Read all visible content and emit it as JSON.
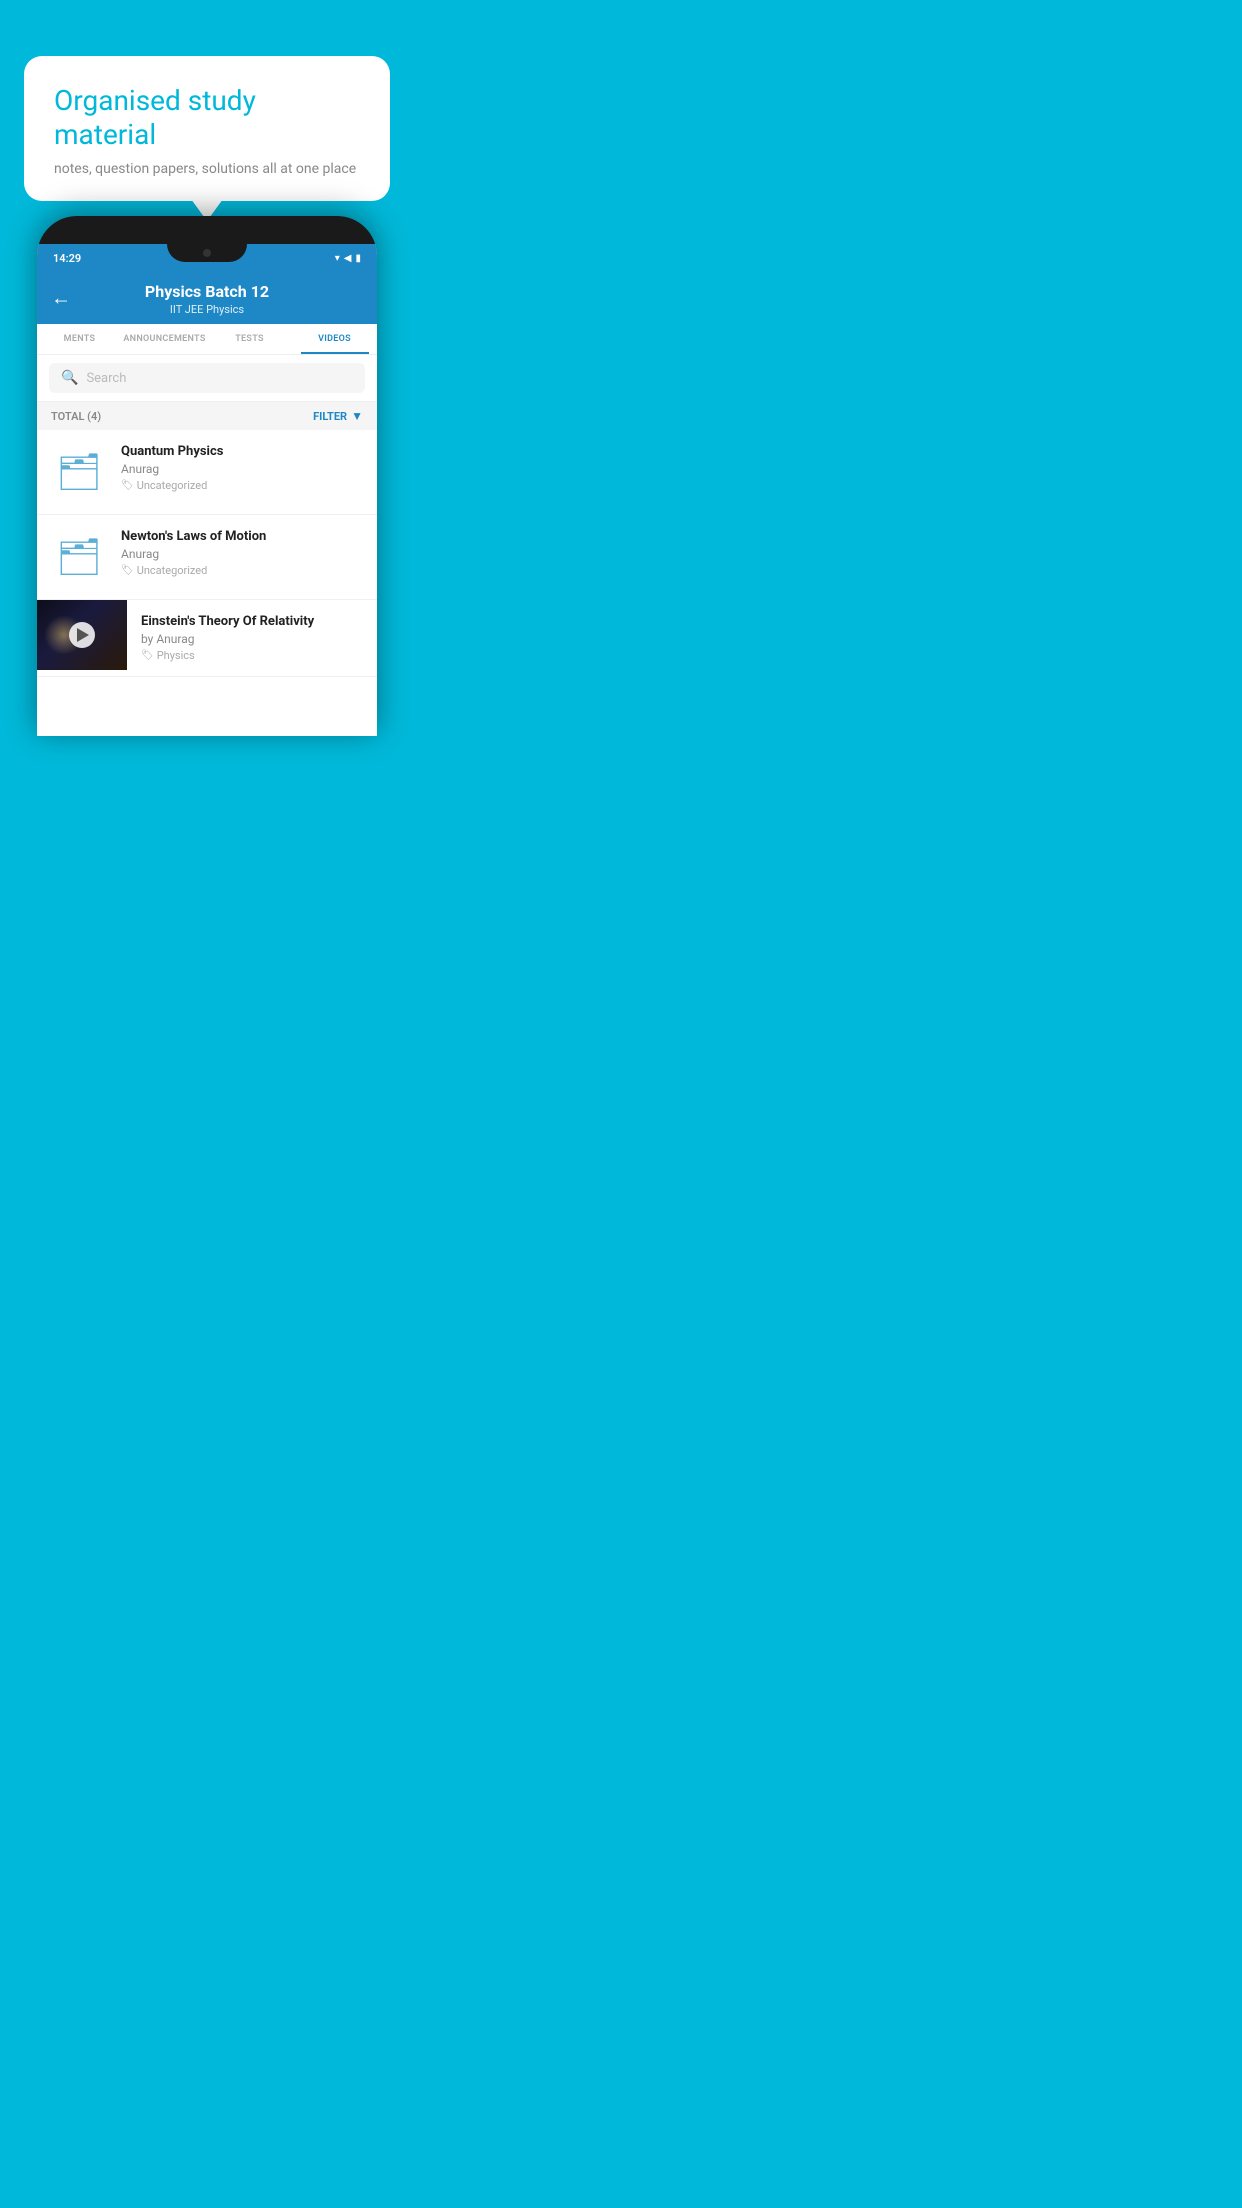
{
  "background_color": "#00b8d9",
  "bubble": {
    "title": "Organised study material",
    "subtitle": "notes, question papers, solutions all at one place"
  },
  "phone": {
    "status_bar": {
      "time": "14:29",
      "icons": [
        "wifi",
        "signal",
        "battery"
      ]
    },
    "header": {
      "back_icon": "←",
      "title": "Physics Batch 12",
      "subtitle": "IIT JEE   Physics"
    },
    "tabs": [
      {
        "label": "MENTS",
        "active": false
      },
      {
        "label": "ANNOUNCEMENTS",
        "active": false
      },
      {
        "label": "TESTS",
        "active": false
      },
      {
        "label": "VIDEOS",
        "active": true
      }
    ],
    "search": {
      "placeholder": "Search"
    },
    "filter": {
      "total_label": "TOTAL (4)",
      "filter_label": "FILTER"
    },
    "videos": [
      {
        "type": "folder",
        "title": "Quantum Physics",
        "author": "Anurag",
        "tag": "Uncategorized"
      },
      {
        "type": "folder",
        "title": "Newton's Laws of Motion",
        "author": "Anurag",
        "tag": "Uncategorized"
      },
      {
        "type": "thumbnail",
        "title": "Einstein's Theory Of Relativity",
        "author": "by Anurag",
        "tag": "Physics"
      }
    ]
  }
}
